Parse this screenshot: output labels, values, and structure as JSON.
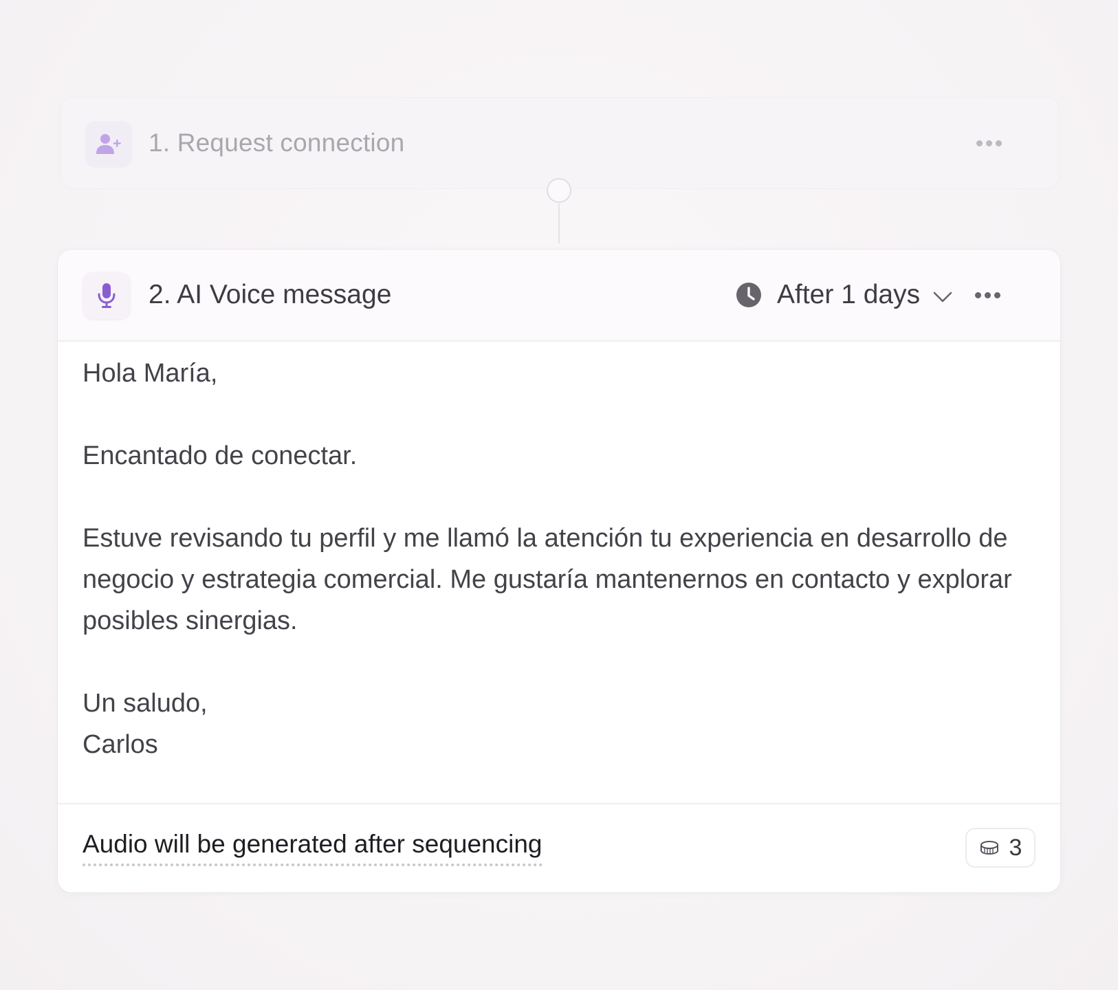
{
  "steps": [
    {
      "title": "1. Request connection",
      "icon": "person-add-icon",
      "state": "faded"
    },
    {
      "title": "2. AI Voice message",
      "icon": "microphone-icon",
      "delay_label": "After 1 days",
      "message": {
        "greeting": "Hola María,",
        "line1": "Encantado de conectar.",
        "paragraph": "Estuve revisando tu perfil y me llamó la atención tu experiencia en desarrollo de negocio y estrategia comercial. Me gustaría mantenernos en contacto y explorar posibles sinergias.",
        "closing": "Un saludo,",
        "signature": "Carlos"
      },
      "footer_note": "Audio will be generated after sequencing",
      "credits": "3"
    }
  ],
  "colors": {
    "accent_purple": "#8a5cd0",
    "faded_purple": "#b79be0",
    "clock_gray": "#67646b"
  }
}
